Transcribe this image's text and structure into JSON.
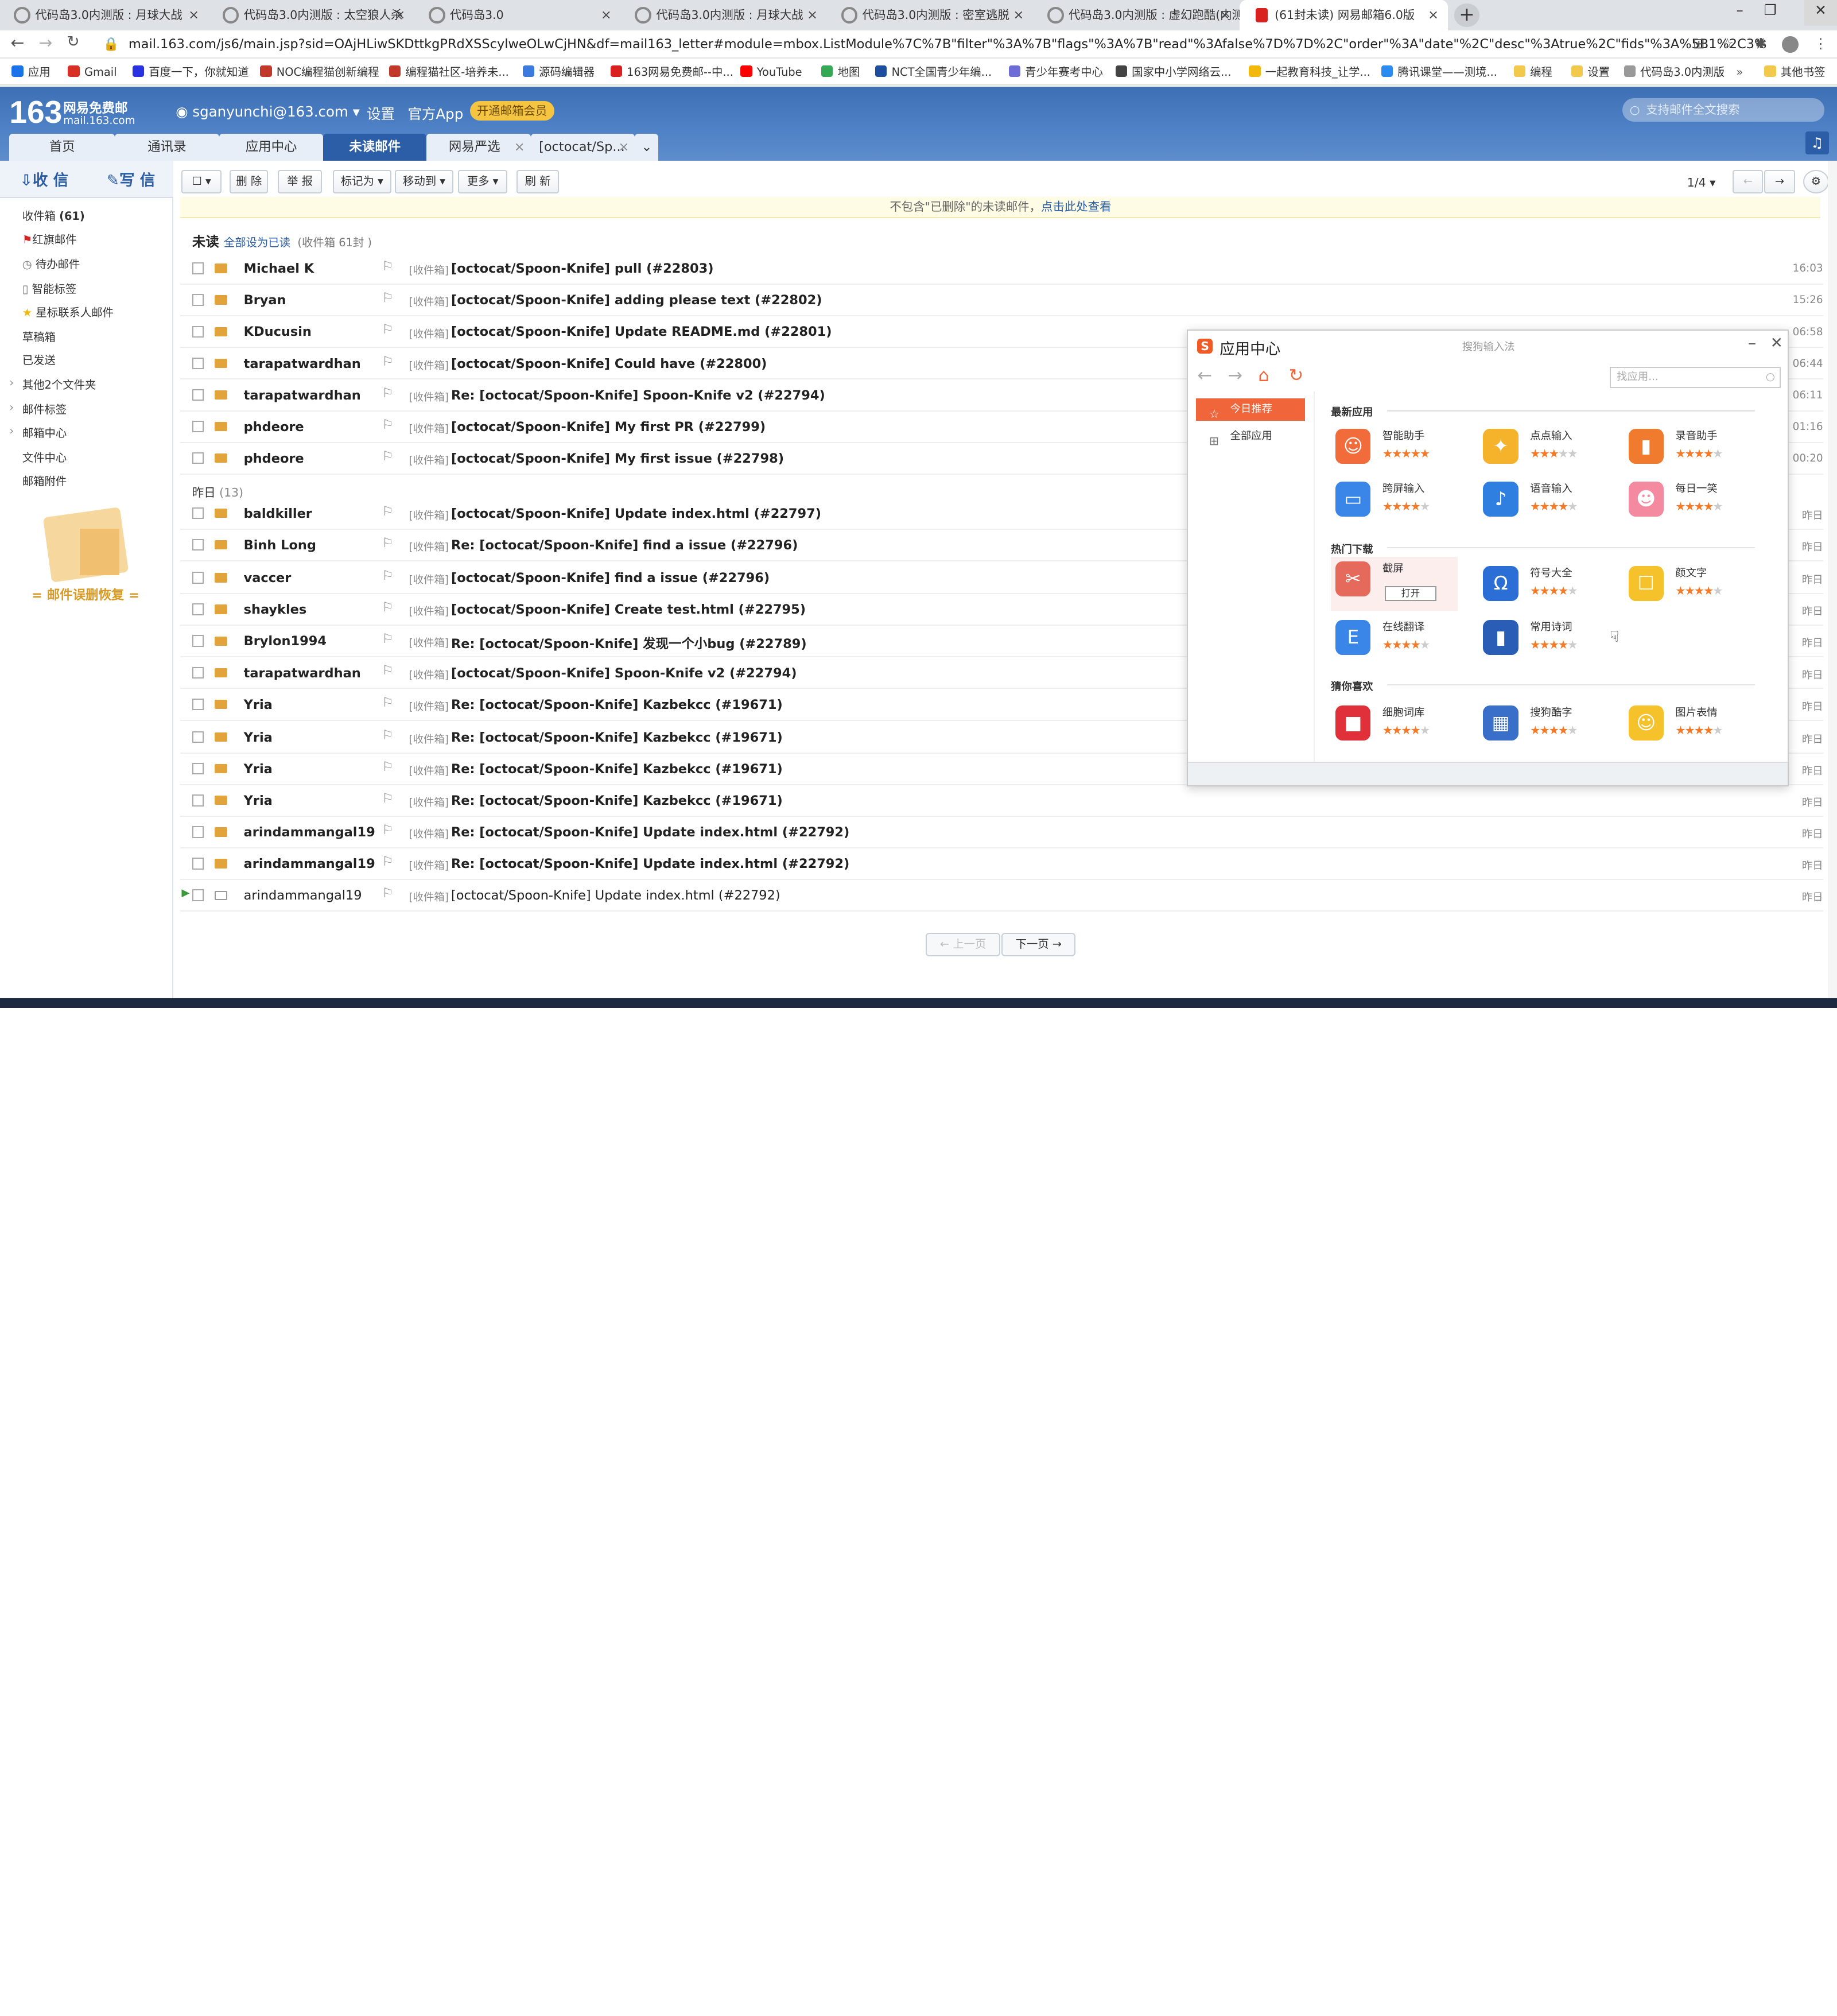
{
  "browser": {
    "tabs": [
      {
        "title": "代码岛3.0内测版 : 月球大战"
      },
      {
        "title": "代码岛3.0内测版 : 太空狼人杀"
      },
      {
        "title": "代码岛3.0"
      },
      {
        "title": "代码岛3.0内测版 : 月球大战"
      },
      {
        "title": "代码岛3.0内测版 : 密室逃脱"
      },
      {
        "title": "代码岛3.0内测版 : 虚幻跑酷(内测"
      },
      {
        "title": "(61封未读) 网易邮箱6.0版"
      }
    ],
    "url": "mail.163.com/js6/main.jsp?sid=OAjHLiwSKDttkgPRdXSScylweOLwCjHN&df=mail163_letter#module=mbox.ListModule%7C%7B\"filter\"%3A%7B\"flags\"%3A%7B\"read\"%3Afalse%7D%7D%2C\"order\"%3A\"date\"%2C\"desc\"%3Atrue%2C\"fids\"%3A%5B1%2C3%5D%7D",
    "bookmarks": [
      "应用",
      "Gmail",
      "百度一下，你就知道",
      "NOC编程猫创新编程",
      "编程猫社区-培养未...",
      "源码编辑器",
      "163网易免费邮--中...",
      "YouTube",
      "地图",
      "NCT全国青少年编...",
      "青少年赛考中心",
      "国家中小学网络云...",
      "一起教育科技_让学...",
      "腾讯课堂——测境...",
      "编程",
      "设置",
      "代码岛3.0内测版",
      "其他书签"
    ]
  },
  "mail": {
    "logo_num": "163",
    "logo_text": "网易免费邮",
    "logo_domain": "mail.163.com",
    "account": "sganyunchi@163.com",
    "settings": "设置",
    "official_app": "官方App",
    "vip": "开通邮箱会员",
    "search_placeholder": "支持邮件全文搜索",
    "tabs": [
      "首页",
      "通讯录",
      "应用中心",
      "未读邮件",
      "网易严选",
      "[octocat/Sp..."
    ],
    "receive": "收 信",
    "write": "写 信",
    "sidebar": [
      {
        "label": "收件箱",
        "count": "(61)"
      },
      {
        "label": "红旗邮件"
      },
      {
        "label": "待办邮件"
      },
      {
        "label": "智能标签"
      },
      {
        "label": "星标联系人邮件"
      },
      {
        "label": "草稿箱"
      },
      {
        "label": "已发送"
      },
      {
        "label": "其他2个文件夹"
      },
      {
        "label": "邮件标签"
      },
      {
        "label": "邮箱中心"
      },
      {
        "label": "文件中心"
      },
      {
        "label": "邮箱附件"
      }
    ],
    "promo": "= 邮件误删恢复 =",
    "toolbar": {
      "delete": "删 除",
      "report": "举 报",
      "mark": "标记为",
      "move": "移动到",
      "more": "更多",
      "refresh": "刷 新",
      "page": "1/4"
    },
    "notice": "不包含\"已删除\"的未读邮件，",
    "notice_link": "点击此处查看",
    "unread_title": "未读",
    "mark_all": "全部设为已读",
    "inbox_count": "(收件箱 61封 )",
    "group_yesterday": "昨日",
    "group_count": "(13)",
    "folder_tag": "[收件箱]",
    "rows": [
      {
        "from": "Michael K",
        "subject": "[octocat/Spoon-Knife] pull (#22803)",
        "date": "16:03"
      },
      {
        "from": "Bryan",
        "subject": "[octocat/Spoon-Knife] adding please text (#22802)",
        "date": "15:26"
      },
      {
        "from": "KDucusin",
        "subject": "[octocat/Spoon-Knife] Update README.md (#22801)",
        "date": "06:58"
      },
      {
        "from": "tarapatwardhan",
        "subject": "[octocat/Spoon-Knife] Could have (#22800)",
        "date": "06:44"
      },
      {
        "from": "tarapatwardhan",
        "subject": "Re: [octocat/Spoon-Knife] Spoon-Knife v2 (#22794)",
        "date": "06:11"
      },
      {
        "from": "phdeore",
        "subject": "[octocat/Spoon-Knife] My first PR (#22799)",
        "date": "01:16"
      },
      {
        "from": "phdeore",
        "subject": "[octocat/Spoon-Knife] My first issue (#22798)",
        "date": "00:20"
      },
      {
        "from": "baldkiller",
        "subject": "[octocat/Spoon-Knife] Update index.html (#22797)",
        "date": "昨日"
      },
      {
        "from": "Binh Long",
        "subject": "Re: [octocat/Spoon-Knife] find a issue (#22796)",
        "date": "昨日"
      },
      {
        "from": "vaccer",
        "subject": "[octocat/Spoon-Knife] find a issue (#22796)",
        "date": "昨日"
      },
      {
        "from": "shaykles",
        "subject": "[octocat/Spoon-Knife] Create test.html (#22795)",
        "date": "昨日"
      },
      {
        "from": "Brylon1994",
        "subject": "Re: [octocat/Spoon-Knife] 发现一个小bug (#22789)",
        "date": "昨日"
      },
      {
        "from": "tarapatwardhan",
        "subject": "[octocat/Spoon-Knife] Spoon-Knife v2 (#22794)",
        "date": "昨日"
      },
      {
        "from": "Yria",
        "subject": "Re: [octocat/Spoon-Knife] Kazbekcc (#19671)",
        "date": "昨日"
      },
      {
        "from": "Yria",
        "subject": "Re: [octocat/Spoon-Knife] Kazbekcc (#19671)",
        "date": "昨日"
      },
      {
        "from": "Yria",
        "subject": "Re: [octocat/Spoon-Knife] Kazbekcc (#19671)",
        "date": "昨日"
      },
      {
        "from": "Yria",
        "subject": "Re: [octocat/Spoon-Knife] Kazbekcc (#19671)",
        "date": "昨日"
      },
      {
        "from": "arindammangal19",
        "subject": "Re: [octocat/Spoon-Knife] Update index.html (#22792)",
        "date": "昨日"
      },
      {
        "from": "arindammangal19",
        "subject": "Re: [octocat/Spoon-Knife] Update index.html (#22792)",
        "date": "昨日"
      },
      {
        "from": "arindammangal19",
        "subject": "[octocat/Spoon-Knife] Update index.html (#22792)",
        "date": "昨日"
      }
    ],
    "prev": "上一页",
    "next": "下一页"
  },
  "appcenter": {
    "title": "应用中心",
    "subtitle": "搜狗输入法",
    "search_placeholder": "找应用...",
    "menu": [
      "今日推荐",
      "全部应用"
    ],
    "sections": [
      "最新应用",
      "热门下载",
      "猜你喜欢"
    ],
    "open_btn": "打开",
    "apps": [
      {
        "name": "智能助手",
        "stars": 5
      },
      {
        "name": "点点输入",
        "stars": 3
      },
      {
        "name": "录音助手",
        "stars": 4
      },
      {
        "name": "跨屏输入",
        "stars": 4
      },
      {
        "name": "语音输入",
        "stars": 4
      },
      {
        "name": "每日一笑",
        "stars": 4
      },
      {
        "name": "截屏",
        "stars": 0
      },
      {
        "name": "符号大全",
        "stars": 4
      },
      {
        "name": "颜文字",
        "stars": 4
      },
      {
        "name": "在线翻译",
        "stars": 4
      },
      {
        "name": "常用诗词",
        "stars": 4
      },
      {
        "name": "细胞词库",
        "stars": 4
      },
      {
        "name": "搜狗酷字",
        "stars": 4
      },
      {
        "name": "图片表情",
        "stars": 4
      }
    ],
    "colors": {
      "accent": "#f0663a",
      "star": "#f47a28"
    }
  }
}
